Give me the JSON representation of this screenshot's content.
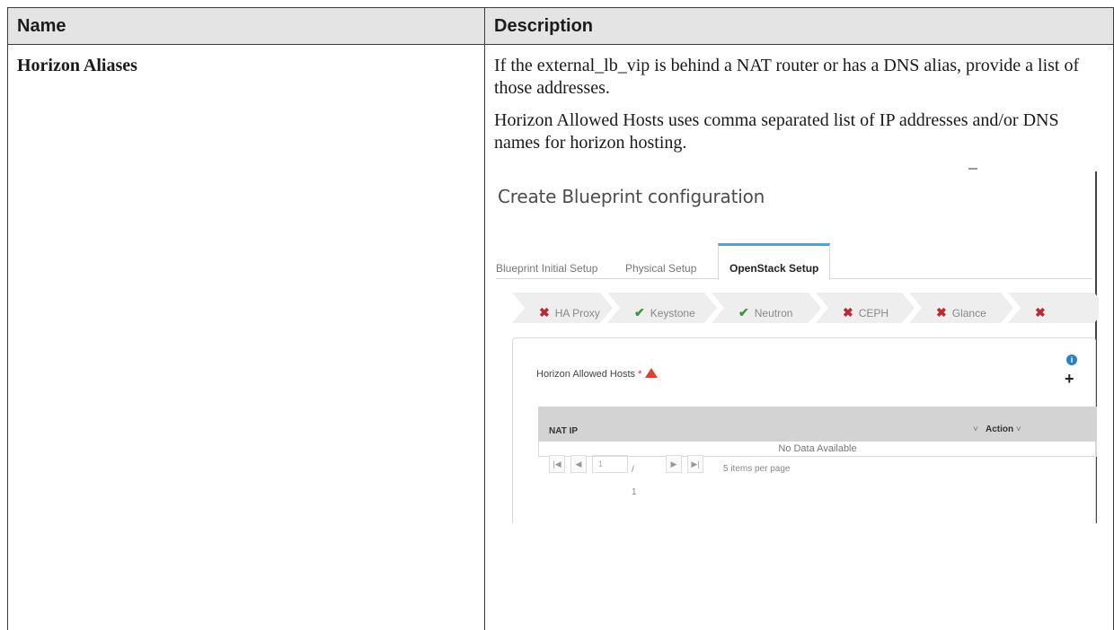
{
  "table": {
    "headers": {
      "name": "Name",
      "description": "Description"
    },
    "row": {
      "name": "Horizon Aliases",
      "paragraphs": [
        "If the external_lb_vip is behind a NAT router or has a DNS alias, provide a list of those addresses.",
        "Horizon Allowed Hosts uses comma separated list of IP addresses and/or DNS names for horizon hosting."
      ]
    }
  },
  "screenshot": {
    "title": "Create Blueprint configuration",
    "tabs": [
      "Blueprint Initial Setup",
      "Physical Setup",
      "OpenStack Setup"
    ],
    "active_tab": "OpenStack Setup",
    "steps": [
      {
        "label": "HA Proxy",
        "status": "error",
        "icon": "x-icon"
      },
      {
        "label": "Keystone",
        "status": "ok",
        "icon": "check-icon"
      },
      {
        "label": "Neutron",
        "status": "ok",
        "icon": "check-icon"
      },
      {
        "label": "CEPH",
        "status": "error",
        "icon": "x-icon"
      },
      {
        "label": "Glance",
        "status": "error",
        "icon": "x-icon"
      },
      {
        "label": "",
        "status": "error",
        "icon": "x-icon"
      }
    ],
    "field_label": "Horizon Allowed Hosts",
    "required_mark": "*",
    "grid": {
      "columns": [
        "NAT IP",
        "Action"
      ],
      "empty_text": "No Data Available"
    },
    "pager": {
      "current_page": "1",
      "total_pages": "/ 1",
      "per_page": "5 items per page"
    },
    "colors": {
      "error": "#c0272d",
      "ok": "#3a9b32",
      "accent": "#49a7d6",
      "info": "#2a80c2"
    }
  }
}
